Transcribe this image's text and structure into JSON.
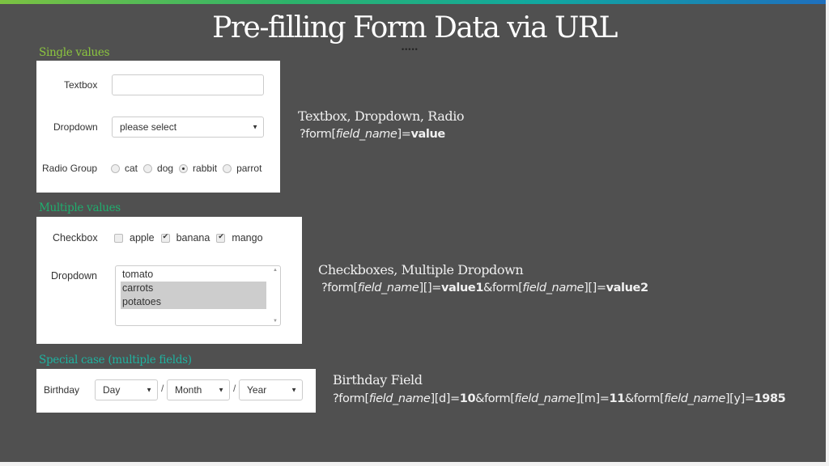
{
  "title": "Pre-filling Form Data via URL",
  "title_dots": "•••••",
  "colors": {
    "background": "#505050",
    "single_label": "#8cc63f",
    "multi_label": "#1fae6e",
    "special_label": "#1fb2a0",
    "selected_option_bg": "#cdcdcd"
  },
  "sections": {
    "single": {
      "label": "Single values",
      "textbox_label": "Textbox",
      "textbox_value": "",
      "dropdown_label": "Dropdown",
      "dropdown_value": "please select",
      "radio_label": "Radio Group",
      "radio_options": [
        "cat",
        "dog",
        "rabbit",
        "parrot"
      ],
      "radio_selected": "rabbit",
      "desc_title": "Textbox, Dropdown, Radio",
      "desc_code": {
        "p1": "?form[",
        "field": "field_name",
        "p2": "]=",
        "value": "value"
      }
    },
    "multiple": {
      "label": "Multiple values",
      "checkbox_label": "Checkbox",
      "checkbox_options": [
        "apple",
        "banana",
        "mango"
      ],
      "checkbox_checked": [
        "banana",
        "mango"
      ],
      "dropdown_label": "Dropdown",
      "list_options": [
        "tomato",
        "carrots",
        "potatoes"
      ],
      "list_selected": [
        "carrots",
        "potatoes"
      ],
      "desc_title": "Checkboxes, Multiple Dropdown",
      "desc_code": {
        "p1": "?form[",
        "field1": "field_name",
        "p2": "][]=",
        "value1": "value1",
        "p3": "&form[",
        "field2": "field_name",
        "p4": "][]=",
        "value2": "value2"
      }
    },
    "special": {
      "label": "Special case (multiple fields)",
      "birthday_label": "Birthday",
      "day_value": "Day",
      "month_value": "Month",
      "year_value": "Year",
      "separator": "/",
      "desc_title": "Birthday Field",
      "desc_code": {
        "p1": "?form[",
        "field1": "field_name",
        "p2": "][d]=",
        "v1": "10",
        "p3": "&form[",
        "field2": "field_name",
        "p4": "][m]=",
        "v2": "11",
        "p5": "&form[",
        "field3": "field_name",
        "p6": "][y]=",
        "v3": "1985"
      }
    }
  }
}
